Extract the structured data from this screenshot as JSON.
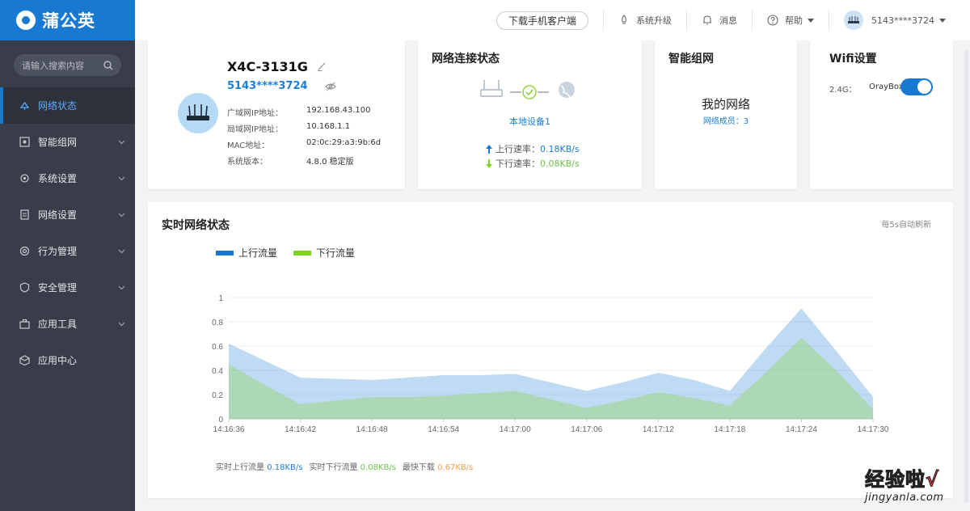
{
  "app": {
    "logo_text": "蒲公英"
  },
  "sidebar": {
    "search_placeholder": "请输入搜索内容",
    "items": [
      {
        "label": "网络状态",
        "active": true
      },
      {
        "label": "智能组网"
      },
      {
        "label": "系统设置"
      },
      {
        "label": "网络设置"
      },
      {
        "label": "行为管理"
      },
      {
        "label": "安全管理"
      },
      {
        "label": "应用工具"
      },
      {
        "label": "应用中心"
      }
    ]
  },
  "topbar": {
    "download_label": "下载手机客户端",
    "upgrade_label": "系统升级",
    "message_label": "消息",
    "help_label": "帮助",
    "user_label": "5143****3724"
  },
  "device": {
    "name": "X4C-3131G",
    "id": "5143****3724",
    "rows": [
      {
        "label": "广域网IP地址：",
        "value": "192.168.43.100"
      },
      {
        "label": "局域网IP地址：",
        "value": "10.168.1.1"
      },
      {
        "label": "MAC地址：",
        "value": "02:0c:29:a3:9b:6d"
      },
      {
        "label": "系统版本：",
        "value": "4.8.0 稳定版"
      }
    ]
  },
  "connection": {
    "title": "网络连接状态",
    "local_device": "本地设备1",
    "up_label": "上行速率：",
    "up_value": "0.18KB/s",
    "down_label": "下行速率：",
    "down_value": "0.08KB/s"
  },
  "mesh": {
    "title": "智能组网",
    "name": "我的网络",
    "members": "网络成员：3"
  },
  "wifi": {
    "title": "Wifi设置",
    "band": "2.4G：",
    "ssid": "OrayBox",
    "enabled": true
  },
  "realtime": {
    "title": "实时网络状态",
    "refresh_note": "每5s自动刷新",
    "stats": [
      {
        "label": "实时上行流量",
        "value": "0.18KB/s",
        "color": "#1c7ed6"
      },
      {
        "label": "实时下行流量",
        "value": "0.08KB/s",
        "color": "#6cc24a"
      },
      {
        "label": "最快下载",
        "value": "0.67KB/s",
        "color": "#f0a04b"
      }
    ]
  },
  "colors": {
    "accent": "#1879d3",
    "upstream": "#1879d3",
    "downstream": "#7ed321"
  },
  "watermark": {
    "top": "经验啦",
    "check": "√",
    "bottom": "jingyanla.com"
  },
  "chart_data": {
    "type": "area",
    "x": [
      "14:16:36",
      "14:16:39",
      "14:16:42",
      "14:16:45",
      "14:16:48",
      "14:16:51",
      "14:16:54",
      "14:16:57",
      "14:17:00",
      "14:17:03",
      "14:17:06",
      "14:17:09",
      "14:17:12",
      "14:17:15",
      "14:17:18",
      "14:17:21",
      "14:17:24",
      "14:17:27",
      "14:17:30"
    ],
    "x_ticks": [
      "14:16:36",
      "14:16:42",
      "14:16:48",
      "14:16:54",
      "14:17:00",
      "14:17:06",
      "14:17:12",
      "14:17:18",
      "14:17:24",
      "14:17:30"
    ],
    "series": [
      {
        "name": "上行流量",
        "values": [
          0.62,
          0.48,
          0.34,
          0.33,
          0.32,
          0.34,
          0.36,
          0.36,
          0.37,
          0.3,
          0.23,
          0.3,
          0.38,
          0.32,
          0.23,
          0.58,
          0.91,
          0.55,
          0.18
        ]
      },
      {
        "name": "下行流量",
        "values": [
          0.45,
          0.28,
          0.12,
          0.15,
          0.18,
          0.18,
          0.19,
          0.21,
          0.23,
          0.16,
          0.09,
          0.15,
          0.22,
          0.17,
          0.11,
          0.38,
          0.67,
          0.39,
          0.08
        ]
      }
    ],
    "yticks": [
      "0",
      "0.2",
      "0.4",
      "0.6",
      "0.8",
      "1"
    ],
    "ylim": [
      0,
      1
    ],
    "grid": true,
    "legend": "top-left"
  }
}
